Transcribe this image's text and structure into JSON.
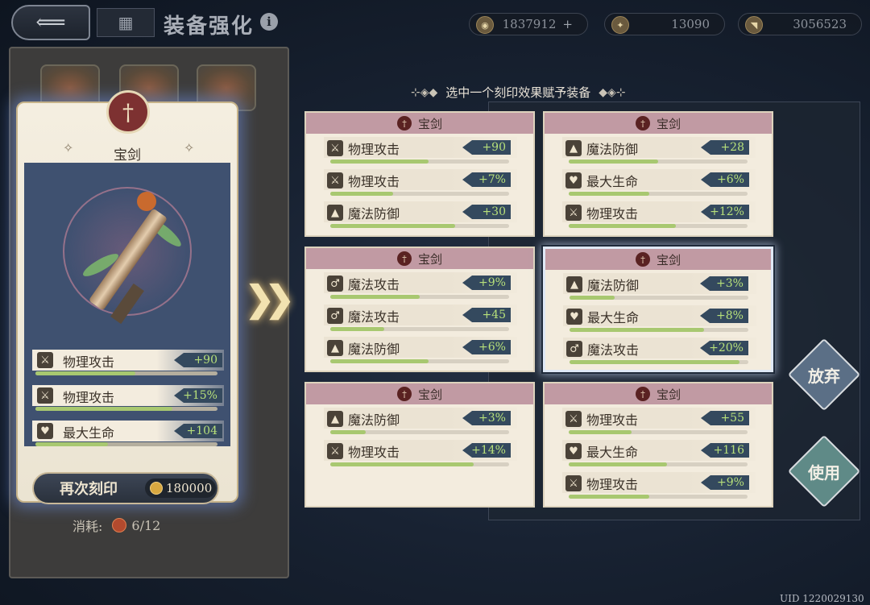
{
  "header": {
    "title": "装备强化",
    "info_glyph": "i",
    "back_glyph": "⟸",
    "menu_glyph": "▦"
  },
  "resources": [
    {
      "value": "1837912",
      "icon": "coin-icon",
      "has_plus": true,
      "plus": "+"
    },
    {
      "value": "13090",
      "icon": "crystal-icon",
      "has_plus": false
    },
    {
      "value": "3056523",
      "icon": "horn-icon",
      "has_plus": false
    }
  ],
  "item": {
    "name": "宝剑",
    "emblem": "†",
    "stats": [
      {
        "name": "物理攻击",
        "value": "+90",
        "icon": "sword-icon",
        "fill": 0.55
      },
      {
        "name": "物理攻击",
        "value": "+15%",
        "icon": "sword-icon",
        "fill": 0.75
      },
      {
        "name": "最大生命",
        "value": "+104",
        "icon": "heart-icon",
        "fill": 0.4
      }
    ]
  },
  "reforge": {
    "label": "再次刻印",
    "cost": "180000"
  },
  "consume": {
    "label": "消耗:",
    "value": "6/12"
  },
  "selector": {
    "title": "选中一个刻印效果赋予装备",
    "orn_left": "⊹◈◆",
    "orn_right": "◆◈⊹"
  },
  "options": [
    {
      "name": "宝剑",
      "selected": false,
      "stats": [
        {
          "name": "物理攻击",
          "value": "+90",
          "icon": "sword-icon",
          "fill": 0.55
        },
        {
          "name": "物理攻击",
          "value": "+7%",
          "icon": "sword-icon",
          "fill": 0.35
        },
        {
          "name": "魔法防御",
          "value": "+30",
          "icon": "hat-icon",
          "fill": 0.7
        }
      ]
    },
    {
      "name": "宝剑",
      "selected": false,
      "stats": [
        {
          "name": "魔法防御",
          "value": "+28",
          "icon": "hat-icon",
          "fill": 0.5
        },
        {
          "name": "最大生命",
          "value": "+6%",
          "icon": "heart-icon",
          "fill": 0.45
        },
        {
          "name": "物理攻击",
          "value": "+12%",
          "icon": "sword-icon",
          "fill": 0.6
        }
      ]
    },
    {
      "name": "宝剑",
      "selected": false,
      "stats": [
        {
          "name": "魔法攻击",
          "value": "+9%",
          "icon": "staff-icon",
          "fill": 0.5
        },
        {
          "name": "魔法攻击",
          "value": "+45",
          "icon": "staff-icon",
          "fill": 0.3
        },
        {
          "name": "魔法防御",
          "value": "+6%",
          "icon": "hat-icon",
          "fill": 0.55
        }
      ]
    },
    {
      "name": "宝剑",
      "selected": true,
      "stats": [
        {
          "name": "魔法防御",
          "value": "+3%",
          "icon": "hat-icon",
          "fill": 0.25
        },
        {
          "name": "最大生命",
          "value": "+8%",
          "icon": "heart-icon",
          "fill": 0.75
        },
        {
          "name": "魔法攻击",
          "value": "+20%",
          "icon": "staff-icon",
          "fill": 0.95
        }
      ]
    },
    {
      "name": "宝剑",
      "selected": false,
      "stats": [
        {
          "name": "魔法防御",
          "value": "+3%",
          "icon": "hat-icon",
          "fill": 0.2
        },
        {
          "name": "物理攻击",
          "value": "+14%",
          "icon": "sword-icon",
          "fill": 0.8
        }
      ]
    },
    {
      "name": "宝剑",
      "selected": false,
      "stats": [
        {
          "name": "物理攻击",
          "value": "+55",
          "icon": "sword-icon",
          "fill": 0.35
        },
        {
          "name": "最大生命",
          "value": "+116",
          "icon": "heart-icon",
          "fill": 0.55
        },
        {
          "name": "物理攻击",
          "value": "+9%",
          "icon": "sword-icon",
          "fill": 0.45
        }
      ]
    }
  ],
  "actions": {
    "discard": "放弃",
    "use": "使用"
  },
  "footer": {
    "uid": "UID 1220029130"
  },
  "colors": {
    "option_header": "#c19aa3",
    "stat_value_bg": "#34495e",
    "stat_value_text": "#b7e07a",
    "bar_fill": "#a8c870",
    "discard": "#5b6f86",
    "use": "#5f8a87"
  },
  "icons": {
    "sword-icon": "⚔",
    "hat-icon": "▲",
    "heart-icon": "♥",
    "staff-icon": "♂",
    "coin-icon": "◉",
    "crystal-icon": "✦",
    "horn-icon": "◥"
  }
}
